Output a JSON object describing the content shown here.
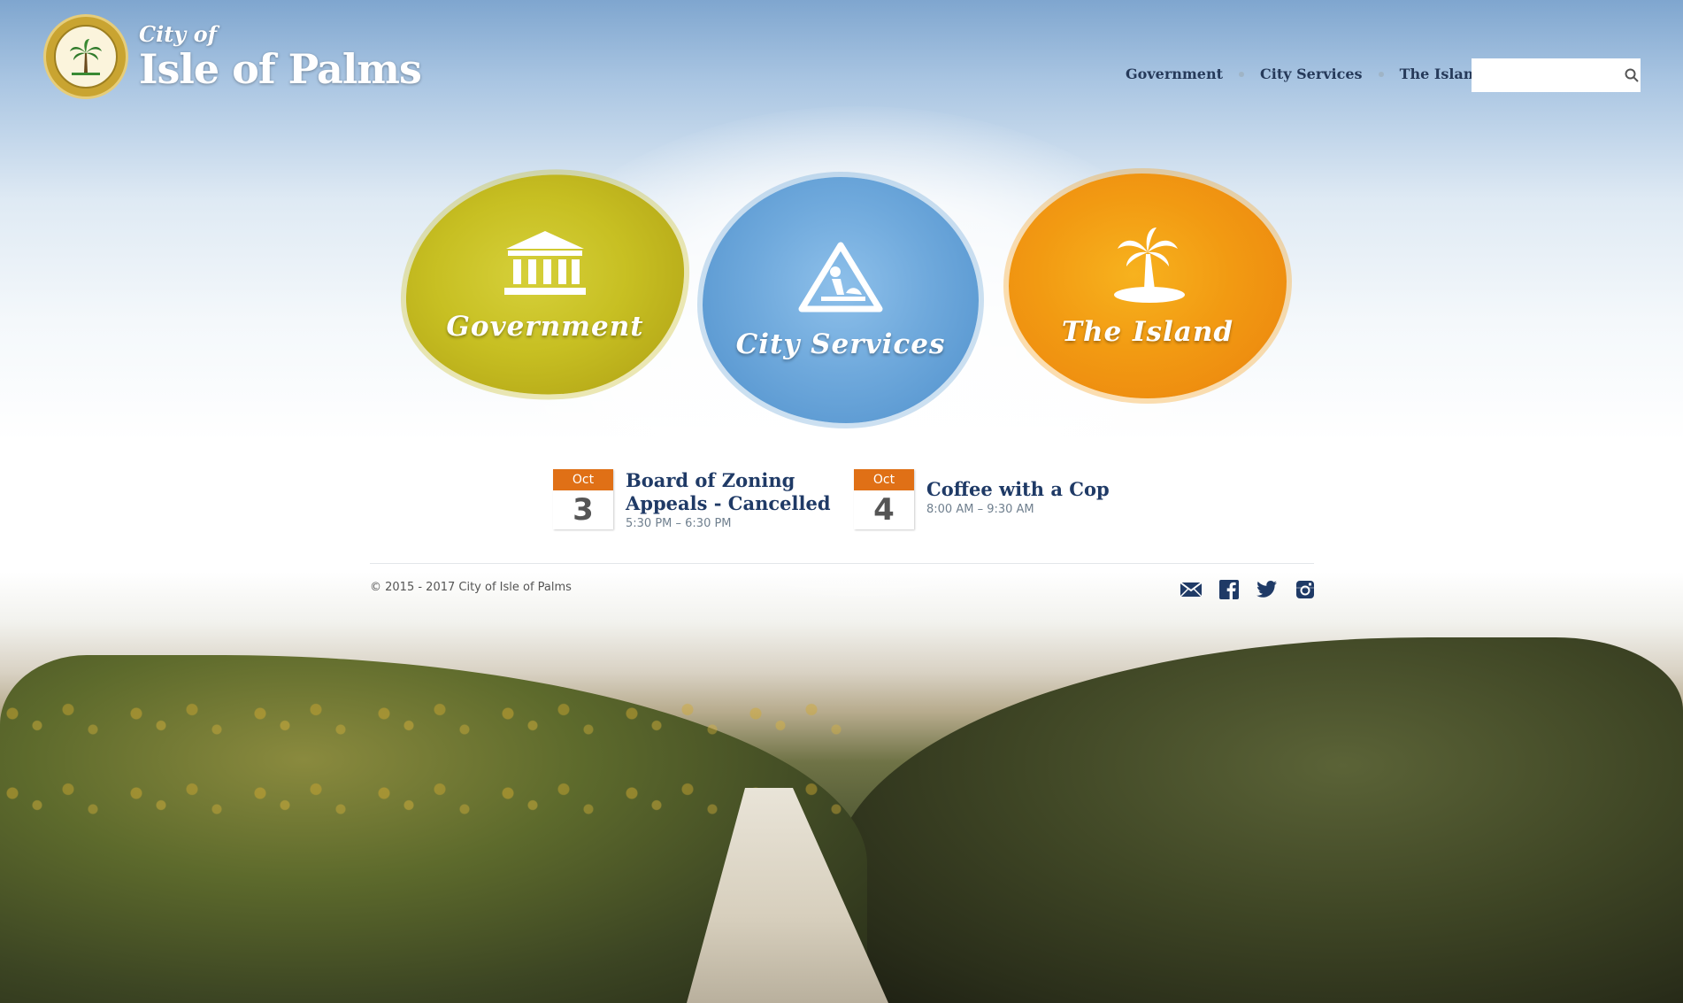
{
  "header": {
    "logo_small": "City of",
    "logo_big": "Isle of Palms",
    "nav": [
      "Government",
      "City Services",
      "The Island"
    ],
    "search_placeholder": ""
  },
  "tiles": [
    {
      "label": "Government",
      "icon": "courthouse-icon",
      "color": "#c7bf22"
    },
    {
      "label": "City Services",
      "icon": "road-work-sign-icon",
      "color": "#6fa9dc"
    },
    {
      "label": "The Island",
      "icon": "palm-island-icon",
      "color": "#f29a12"
    }
  ],
  "events": [
    {
      "month": "Oct",
      "day": "3",
      "title_line1": "Board of Zoning",
      "title_line2": "Appeals - Cancelled",
      "time": "5:30 PM – 6:30 PM"
    },
    {
      "month": "Oct",
      "day": "4",
      "title_line1": "Coffee with a Cop",
      "title_line2": "",
      "time": "8:00 AM – 9:30 AM"
    }
  ],
  "footer": {
    "copyright": "© 2015 - 2017 City of Isle of Palms",
    "social": [
      "email-icon",
      "facebook-icon",
      "twitter-icon",
      "instagram-icon"
    ]
  },
  "colors": {
    "accent_orange": "#e07016",
    "navy": "#1f3a66"
  }
}
